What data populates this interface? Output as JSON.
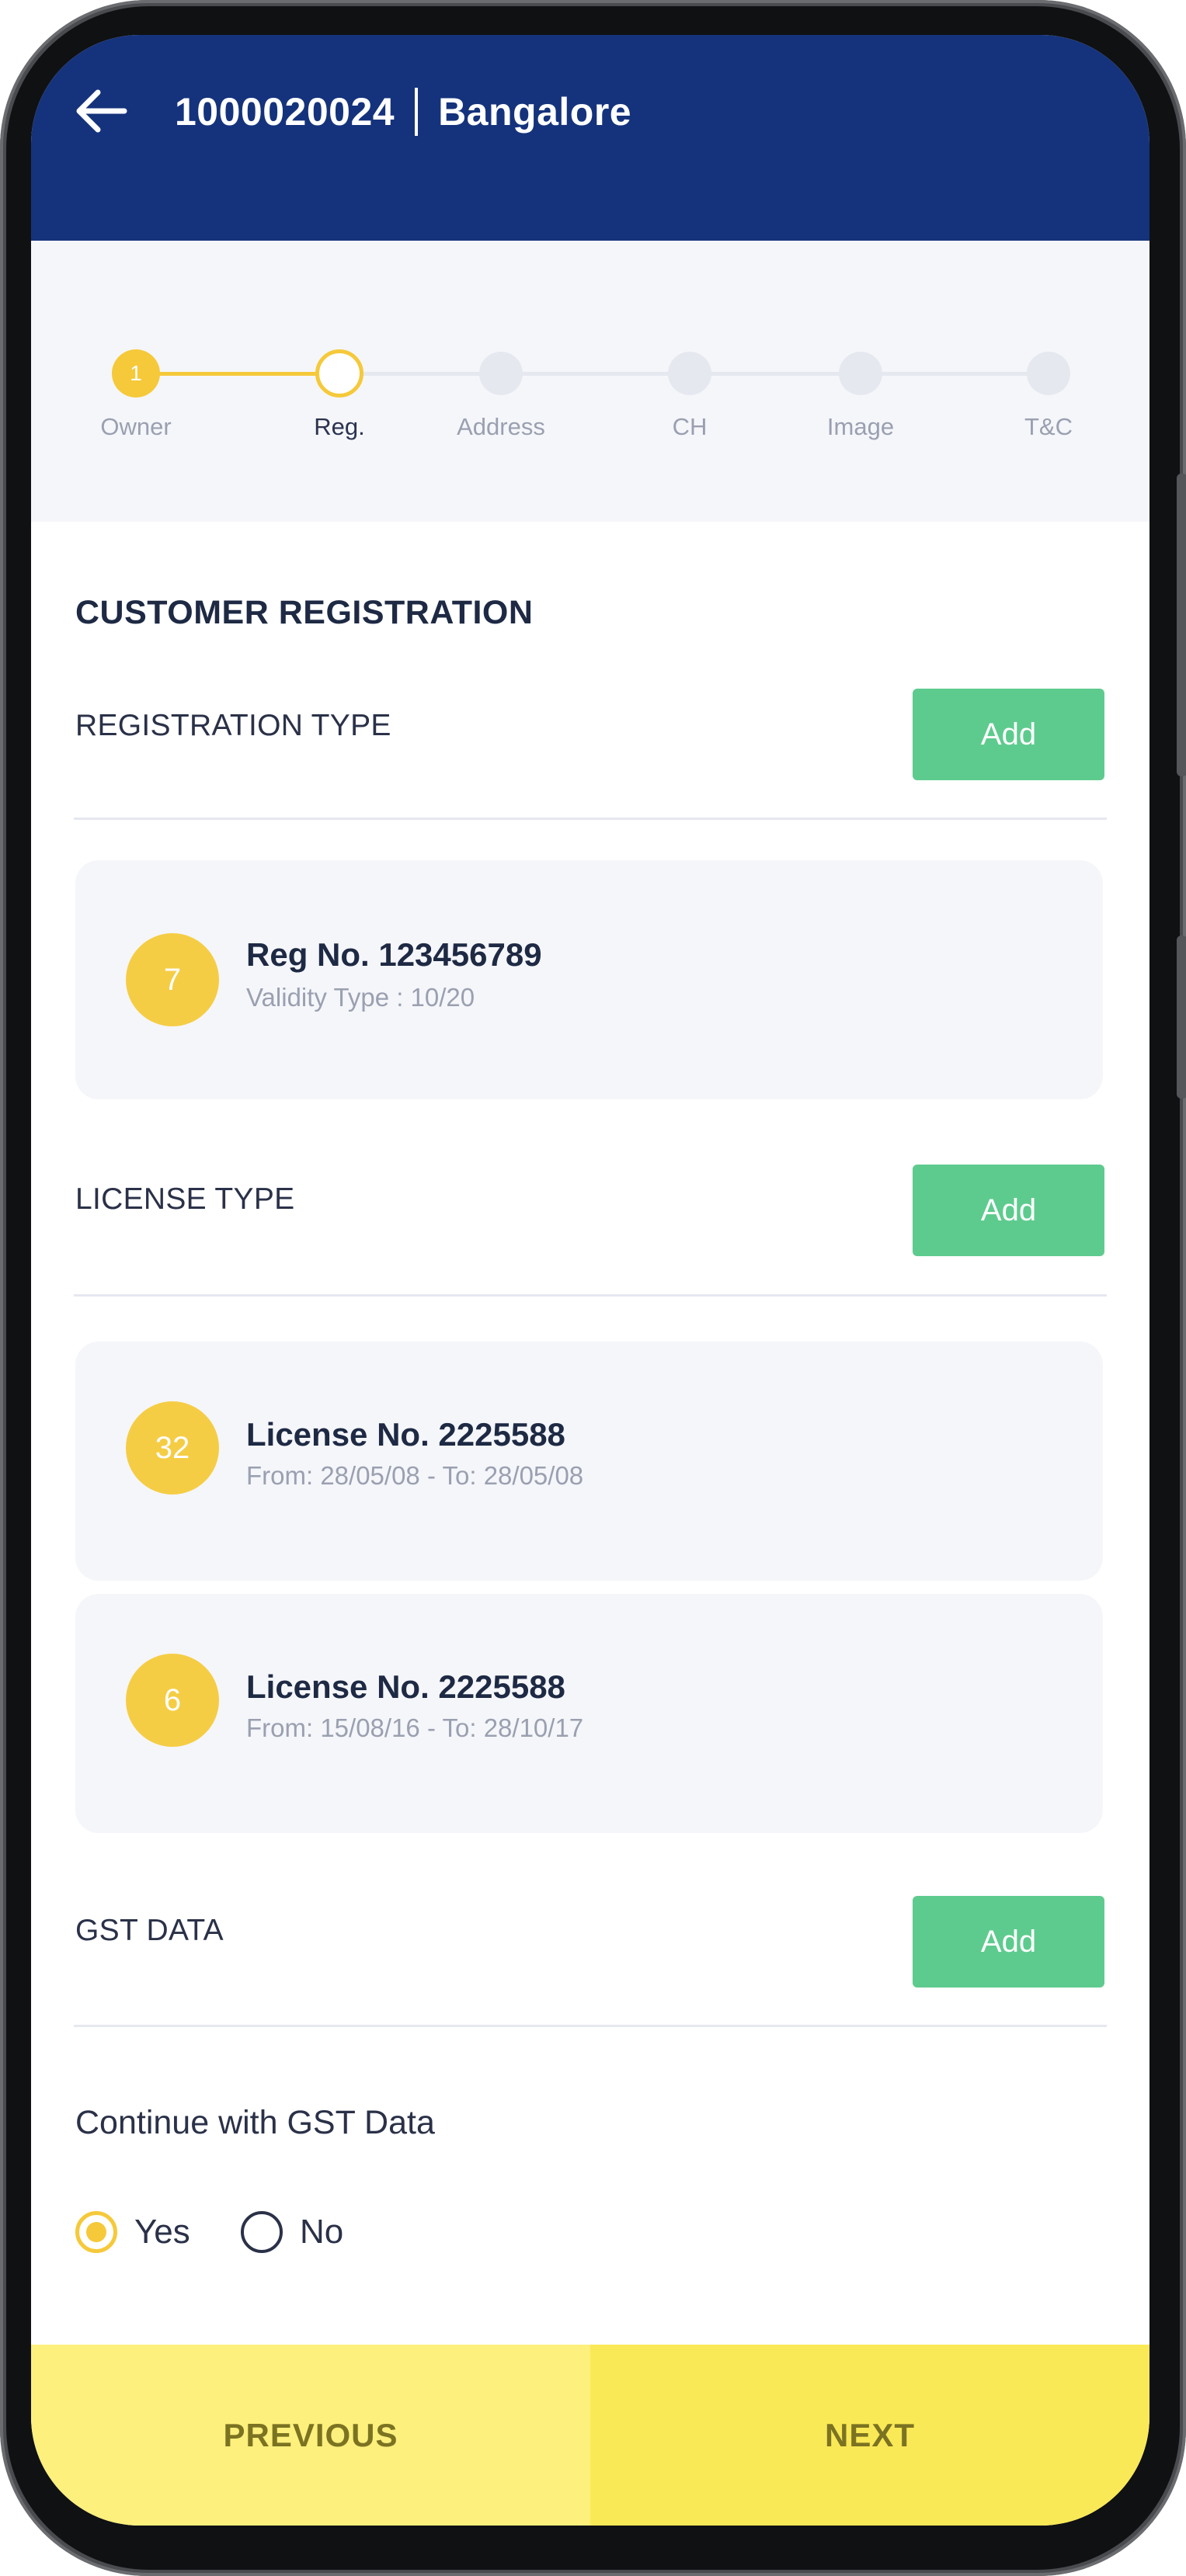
{
  "header": {
    "customer_id": "1000020024",
    "city": "Bangalore",
    "background_color": "#15337c"
  },
  "stepper": {
    "accent_color": "#f5c93a",
    "current_step": 2,
    "steps": [
      {
        "label": "Owner",
        "number": "1",
        "state": "done"
      },
      {
        "label": "Reg.",
        "state": "active"
      },
      {
        "label": "Address",
        "state": "todo"
      },
      {
        "label": "CH",
        "state": "todo"
      },
      {
        "label": "Image",
        "state": "todo"
      },
      {
        "label": "T&C",
        "state": "todo"
      }
    ]
  },
  "main": {
    "section_title": "CUSTOMER REGISTRATION",
    "registration": {
      "label": "REGISTRATION TYPE",
      "add_label": "Add",
      "items": [
        {
          "badge": "7",
          "title": "Reg No. 123456789",
          "subtitle": "Validity Type : 10/20"
        }
      ]
    },
    "license": {
      "label": "LICENSE TYPE",
      "add_label": "Add",
      "items": [
        {
          "badge": "32",
          "title": "License No. 2225588",
          "subtitle": "From: 28/05/08 - To: 28/05/08"
        },
        {
          "badge": "6",
          "title": "License No. 2225588",
          "subtitle": "From: 15/08/16 - To: 28/10/17"
        }
      ]
    },
    "gst": {
      "label": "GST DATA",
      "add_label": "Add",
      "question": "Continue with GST Data",
      "options": [
        {
          "label": "Yes",
          "selected": true
        },
        {
          "label": "No",
          "selected": false
        }
      ]
    },
    "add_button_color": "#5ecb8e"
  },
  "footer": {
    "previous_label": "PREVIOUS",
    "next_label": "NEXT"
  },
  "icons": {
    "back": "arrow-left-icon"
  }
}
